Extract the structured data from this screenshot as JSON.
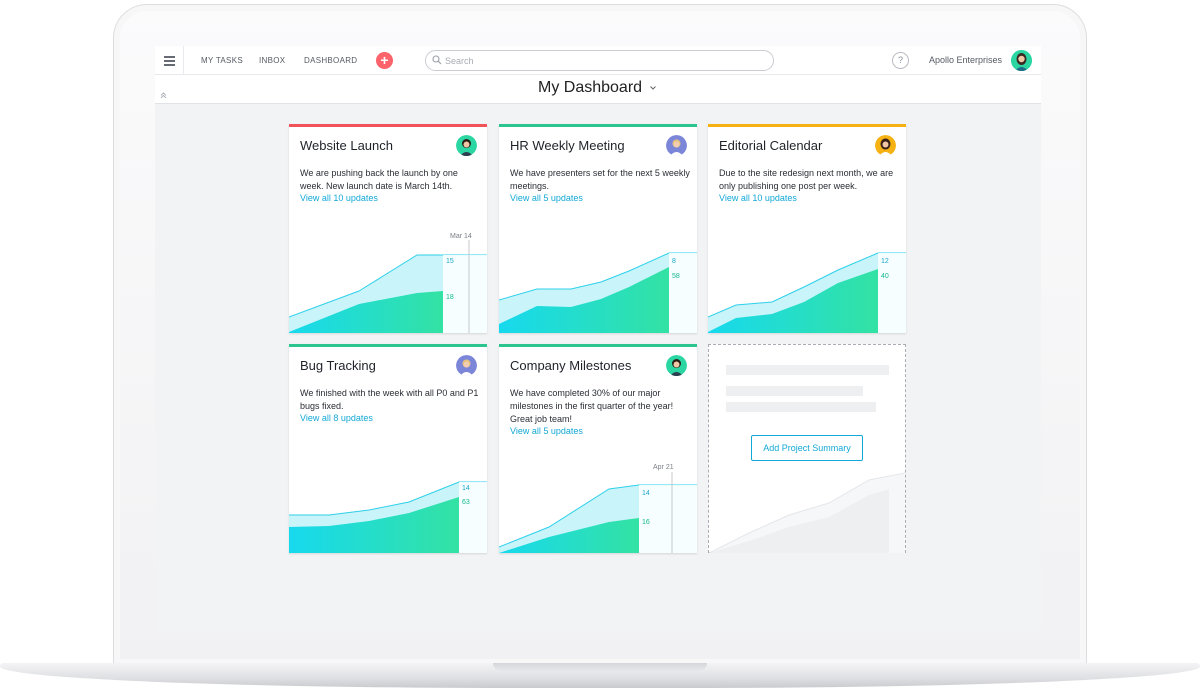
{
  "nav": {
    "my_tasks": "MY TASKS",
    "inbox": "INBOX",
    "dashboard": "DASHBOARD",
    "add_symbol": "+"
  },
  "search": {
    "placeholder": "Search"
  },
  "help_symbol": "?",
  "org_name": "Apollo Enterprises",
  "page_title": "My Dashboard",
  "colors": {
    "red": "#f0545a",
    "teal": "#2cc48f",
    "amber": "#f5b212",
    "link": "#13a8d6",
    "add_button": "#fc636b"
  },
  "cards": [
    {
      "title": "Website Launch",
      "accent": "#f0545a",
      "description": "We are pushing back the launch by one week. New launch date is March 14th.",
      "link": "View all 10 updates",
      "date_marker": "Mar 14",
      "label_top": "15",
      "label_bottom": "18"
    },
    {
      "title": "HR Weekly Meeting",
      "accent": "#2cc48f",
      "description": "We have presenters set for the next 5 weekly meetings.",
      "link": "View all 5 updates",
      "date_marker": "",
      "label_top": "8",
      "label_bottom": "58"
    },
    {
      "title": "Editorial Calendar",
      "accent": "#f5b212",
      "description": "Due to the site redesign next month, we are only publishing one post per week.",
      "link": "View all 10 updates",
      "date_marker": "",
      "label_top": "12",
      "label_bottom": "40"
    },
    {
      "title": "Bug Tracking",
      "accent": "#2cc48f",
      "description": "We finished with the week with all P0 and P1 bugs fixed.",
      "link": "View all 8 updates",
      "date_marker": "",
      "label_top": "14",
      "label_bottom": "63"
    },
    {
      "title": "Company Milestones",
      "accent": "#2cc48f",
      "description": "We have completed 30% of our major milestones in the first quarter of the year! Great job team!",
      "link": "View all 5 updates",
      "date_marker": "Apr 21",
      "label_top": "14",
      "label_bottom": "16"
    }
  ],
  "add_summary_label": "Add Project Summary"
}
